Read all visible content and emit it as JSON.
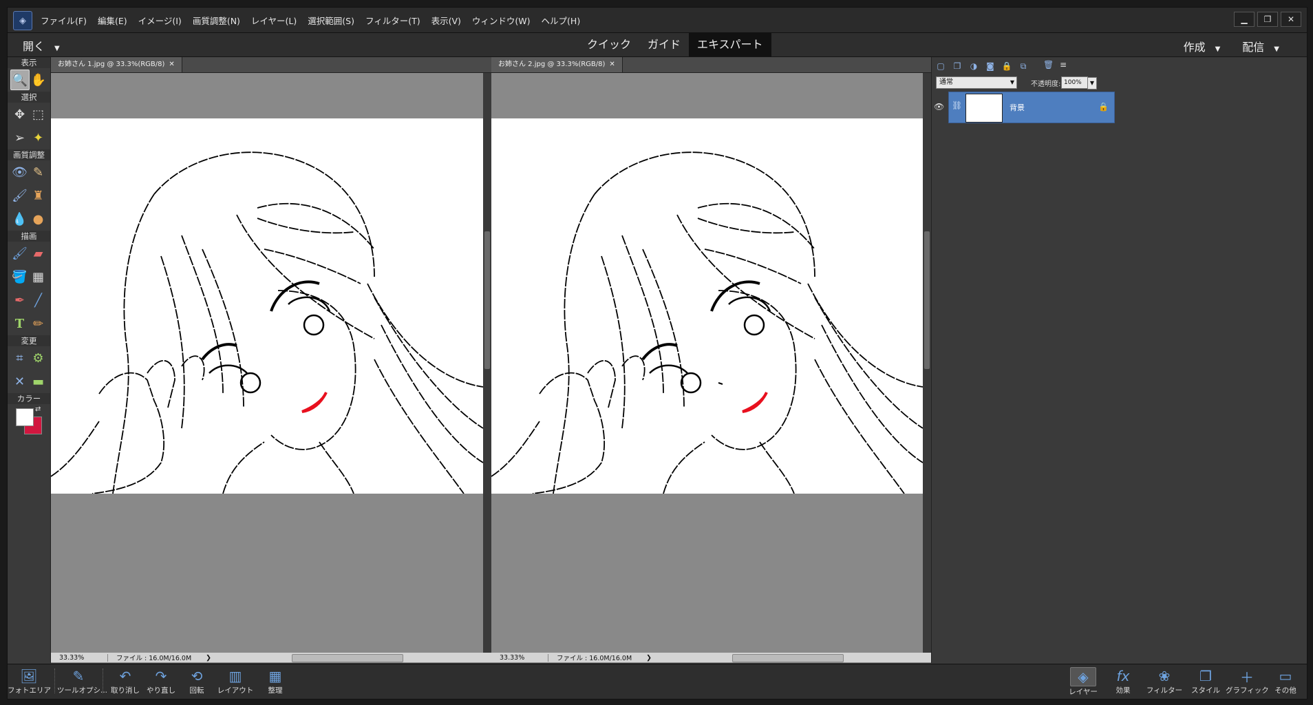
{
  "menu": [
    "ファイル(F)",
    "編集(E)",
    "イメージ(I)",
    "画質調整(N)",
    "レイヤー(L)",
    "選択範囲(S)",
    "フィルター(T)",
    "表示(V)",
    "ウィンドウ(W)",
    "ヘルプ(H)"
  ],
  "modebar": {
    "open": "開く",
    "modes": [
      "クイック",
      "ガイド",
      "エキスパート"
    ],
    "active_mode": "エキスパート",
    "right": [
      "作成",
      "配信"
    ]
  },
  "toolbox": {
    "sections": {
      "view": "表示",
      "select": "選択",
      "enhance": "画質調整",
      "draw": "描画",
      "modify": "変更",
      "color": "カラー"
    },
    "fg_color": "#ffffff",
    "bg_color": "#d1163f"
  },
  "documents": [
    {
      "tab": "お姉さん 1.jpg @ 33.3%(RGB/8)",
      "zoom": "33.33%",
      "filesize": "ファイル : 16.0M/16.0M"
    },
    {
      "tab": "お姉さん 2.jpg @ 33.3%(RGB/8)",
      "zoom": "33.33%",
      "filesize": "ファイル : 16.0M/16.0M"
    }
  ],
  "layers_panel": {
    "blend_mode": "通常",
    "opacity_label": "不透明度:",
    "opacity_value": "100%",
    "layers": [
      {
        "name": "背景"
      }
    ]
  },
  "bottombar": {
    "left": [
      "フォトエリア",
      "ツールオプシ...",
      "取り消し",
      "やり直し",
      "回転",
      "レイアウト",
      "整理"
    ],
    "right": [
      "レイヤー",
      "効果",
      "フィルター",
      "スタイル",
      "グラフィック",
      "その他"
    ]
  },
  "colors": {
    "lip_red": "#e8101e",
    "selected_layer": "#4e7ebf"
  }
}
